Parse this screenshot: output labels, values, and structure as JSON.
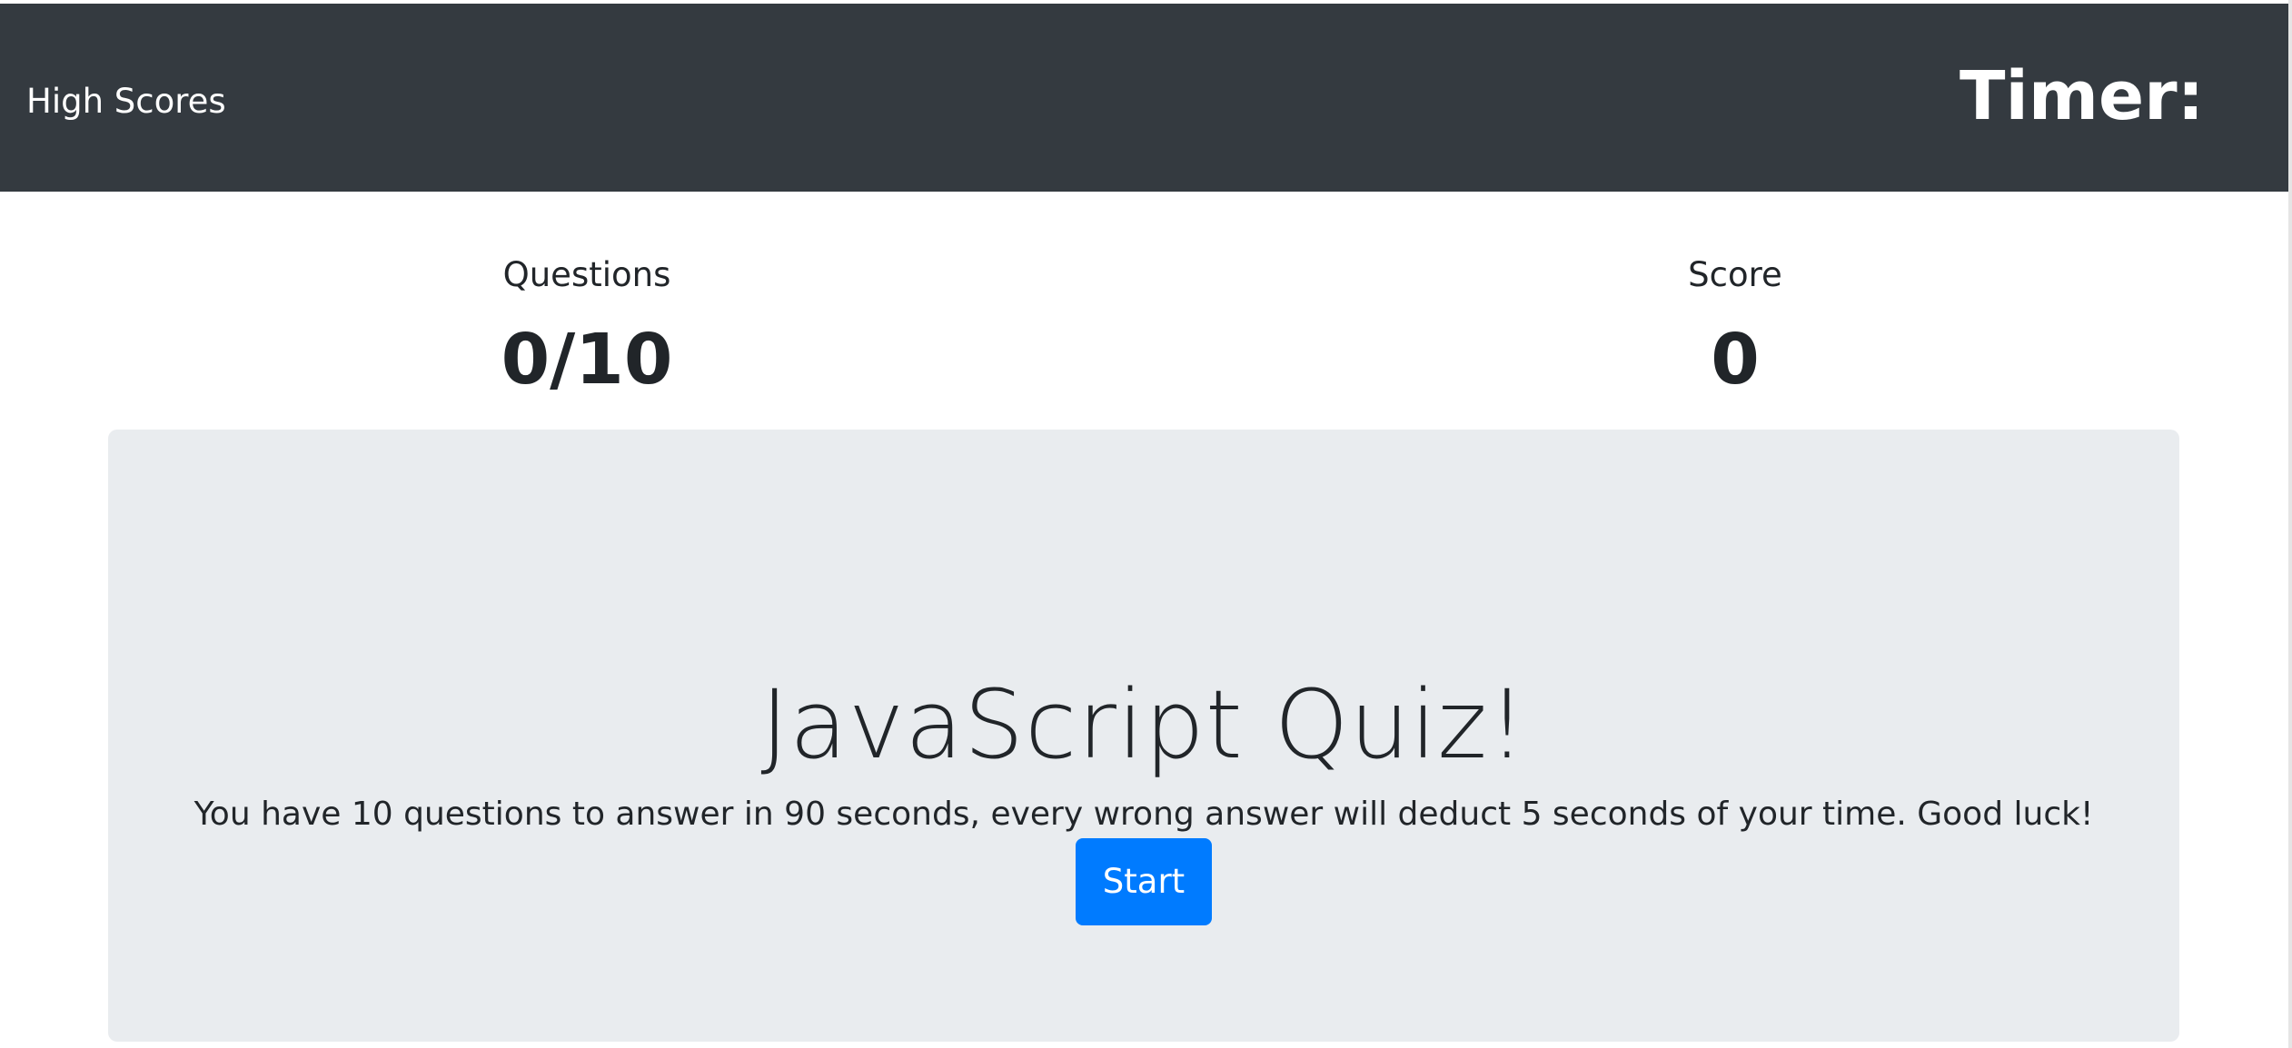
{
  "navbar": {
    "high_scores_label": "High Scores",
    "timer_label": "Timer:",
    "timer_value": "",
    "background_color": "#343a40"
  },
  "stats": {
    "questions_label": "Questions",
    "questions_value": "0/10",
    "score_label": "Score",
    "score_value": "0"
  },
  "jumbotron": {
    "title": "JavaScript Quiz!",
    "lead": "You have 10 questions to answer in 90 seconds, every wrong answer will deduct 5 seconds of your time. Good luck!",
    "start_label": "Start",
    "background_color": "#e9ecef",
    "button_color": "#007bff"
  }
}
